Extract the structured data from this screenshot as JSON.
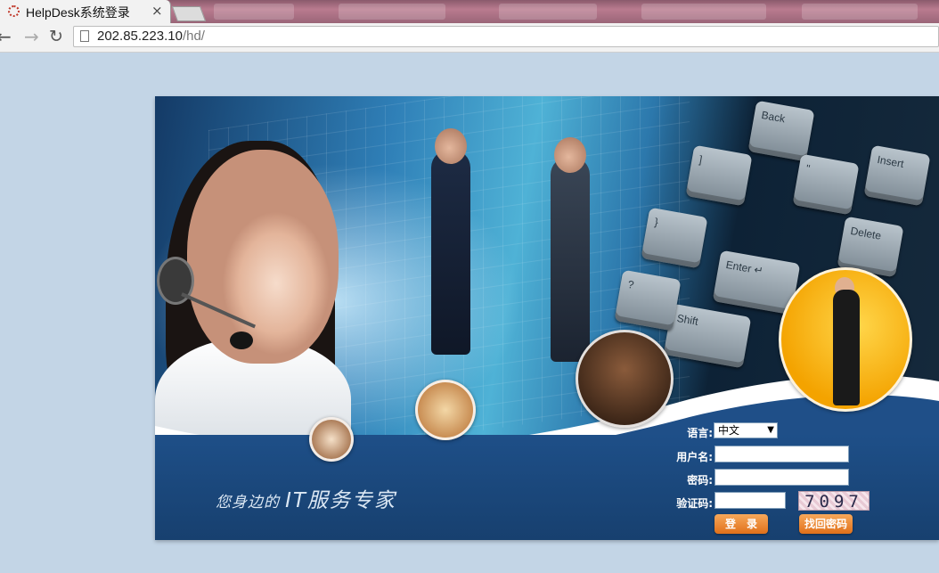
{
  "browser": {
    "tab_title": "HelpDesk系统登录",
    "tab_close": "×",
    "url_host": "202.85.223.10",
    "url_path": "/hd/",
    "nav": {
      "back": "←",
      "forward": "→",
      "reload": "↻"
    }
  },
  "banner": {
    "slogan_prefix": "您身边的",
    "slogan_main": "IT服务专家",
    "keys": [
      "Back",
      "Enter ↵",
      "Shift",
      "Delete",
      "Insert",
      "]",
      "}",
      "?",
      "\""
    ]
  },
  "login": {
    "language_label": "语言:",
    "language_value": "中文",
    "username_label": "用户名:",
    "username_value": "",
    "password_label": "密码:",
    "password_value": "",
    "captcha_label": "验证码:",
    "captcha_value": "",
    "captcha_image_text": "7097",
    "login_button": "登　录",
    "recover_button": "找回密码"
  },
  "colors": {
    "page_background": "#c3d5e6",
    "banner_band": "#1e4f88",
    "button_orange": "#e0701a"
  }
}
